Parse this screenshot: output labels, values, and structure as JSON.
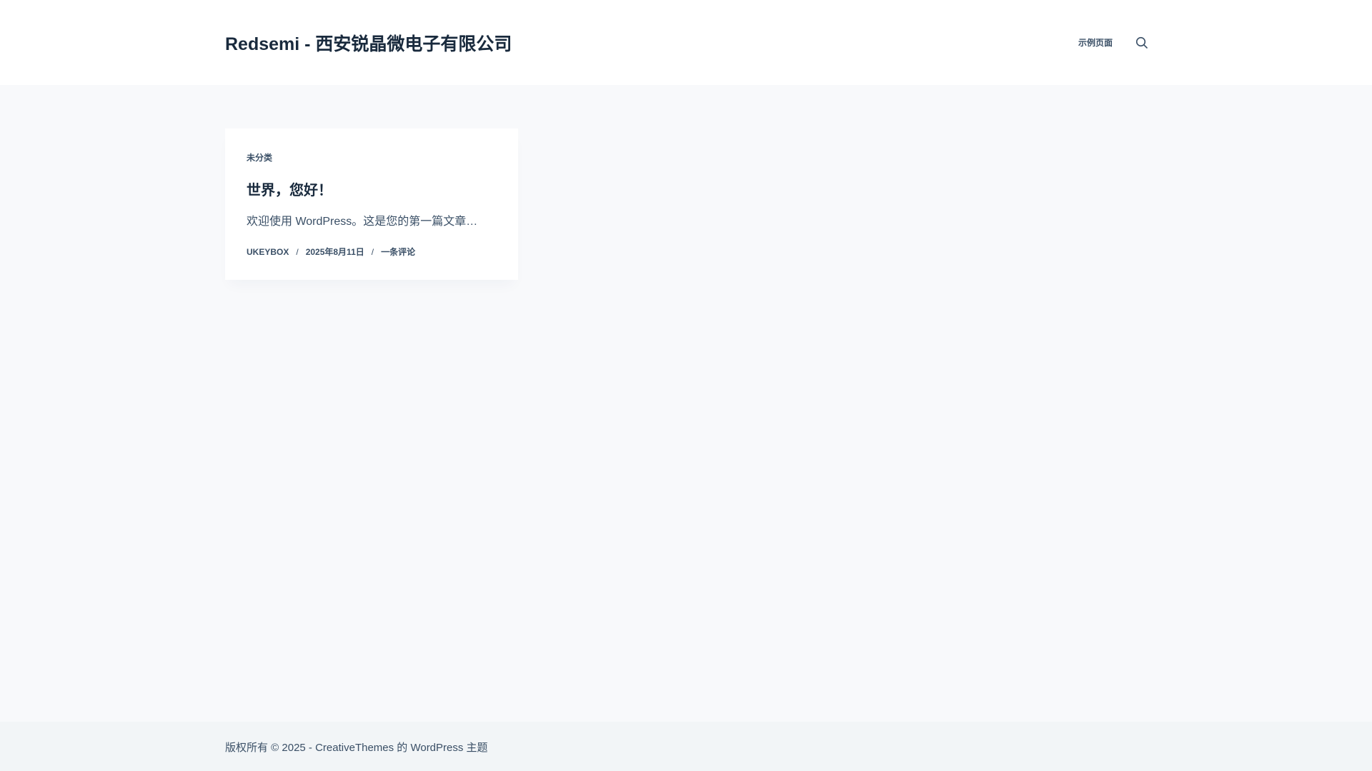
{
  "header": {
    "site_title": "Redsemi - 西安锐晶微电子有限公司",
    "nav_item": "示例页面",
    "search_icon": "search-icon"
  },
  "post": {
    "category": "未分类",
    "title": "世界，您好！",
    "excerpt": "欢迎使用 WordPress。这是您的第一篇文章…",
    "author": "UKEYBOX",
    "date": "2025年8月11日",
    "comments": "一条评论",
    "meta_separator": "/"
  },
  "footer": {
    "copyright": "版权所有 © 2025 - CreativeThemes 的 WordPress 主题"
  },
  "colors": {
    "background": "#f8f9fb",
    "header_background": "#ffffff",
    "footer_background": "#f2f5f7",
    "heading": "#192a3d",
    "text": "#3a4f66"
  }
}
